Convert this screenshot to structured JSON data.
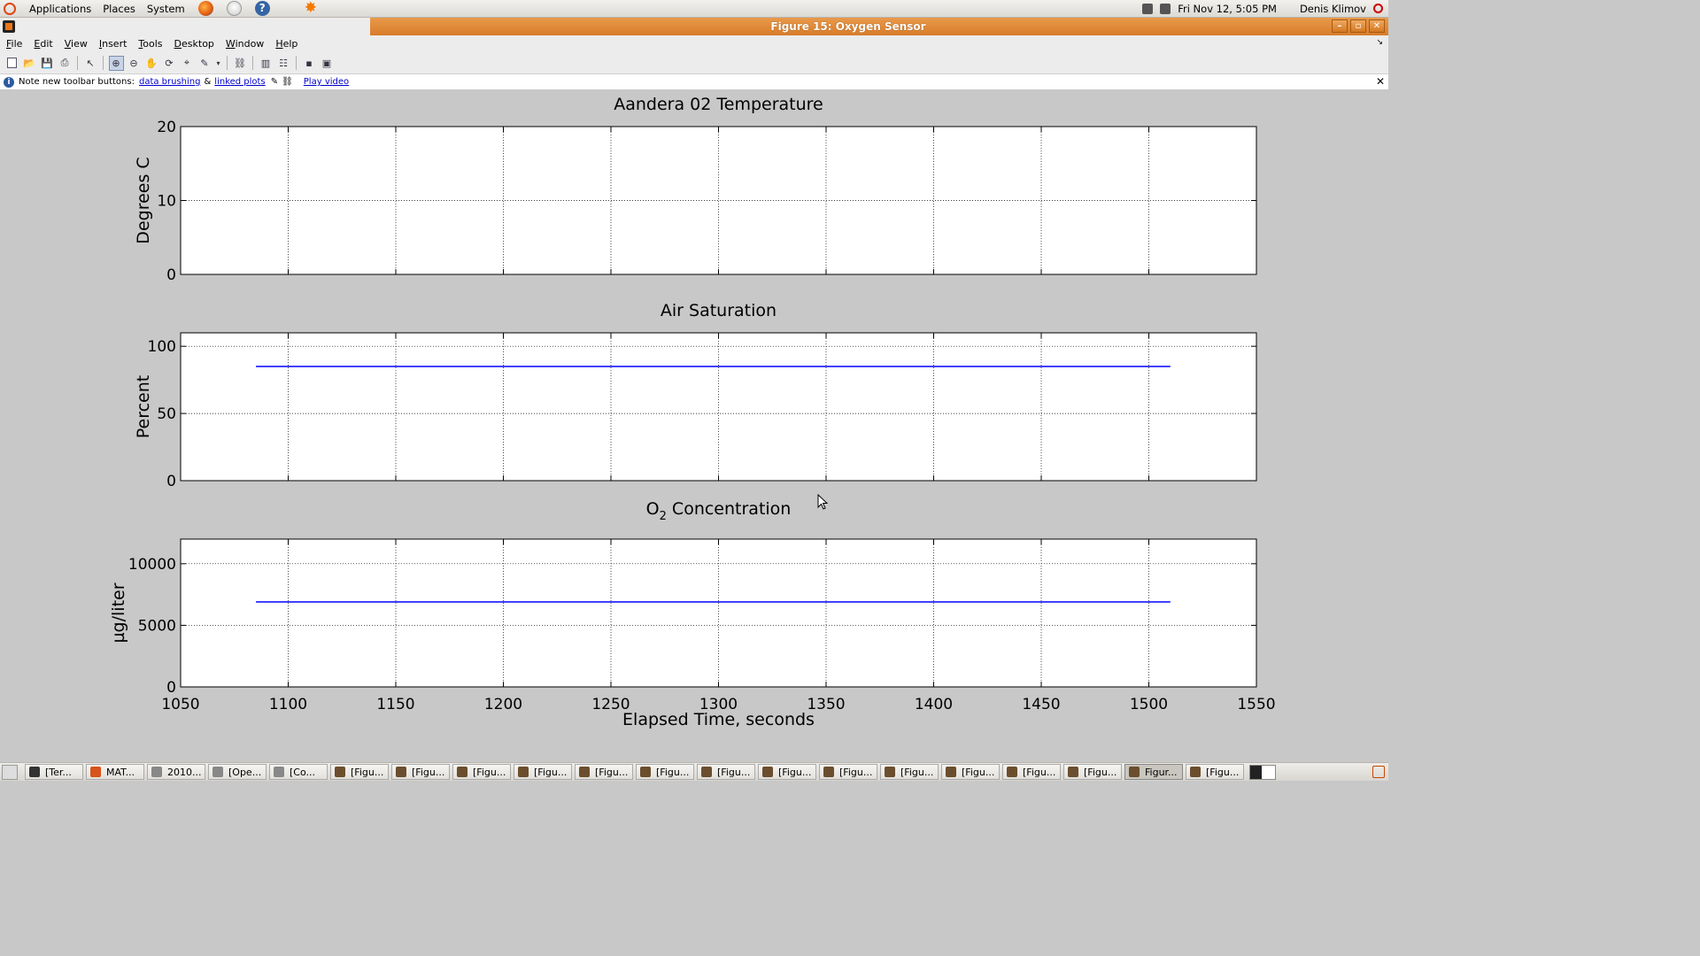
{
  "top_panel": {
    "menus": [
      "Applications",
      "Places",
      "System"
    ],
    "clock": "Fri Nov 12,  5:05 PM",
    "user": "Denis Klimov"
  },
  "window": {
    "title": "Figure 15: Oxygen Sensor"
  },
  "menubar": {
    "items": [
      "File",
      "Edit",
      "View",
      "Insert",
      "Tools",
      "Desktop",
      "Window",
      "Help"
    ]
  },
  "infobar": {
    "text": "Note new toolbar buttons:",
    "link1": "data brushing",
    "amp": "&",
    "link2": "linked plots",
    "link3": "Play video",
    "close": "✕"
  },
  "chart_data": [
    {
      "type": "line",
      "title": "Aandera 02 Temperature",
      "xlabel": "",
      "ylabel": "Degrees C",
      "xlim": [
        1050,
        1550
      ],
      "ylim": [
        0,
        20
      ],
      "xticks": [
        1100,
        1150,
        1200,
        1250,
        1300,
        1350,
        1400,
        1450,
        1500
      ],
      "yticks": [
        0,
        10,
        20
      ],
      "grid": true,
      "series": []
    },
    {
      "type": "line",
      "title": "Air Saturation",
      "xlabel": "",
      "ylabel": "Percent",
      "xlim": [
        1050,
        1550
      ],
      "ylim": [
        0,
        110
      ],
      "xticks": [
        1100,
        1150,
        1200,
        1250,
        1300,
        1350,
        1400,
        1450,
        1500
      ],
      "yticks": [
        0,
        50,
        100
      ],
      "grid": true,
      "series": [
        {
          "x": [
            1085,
            1200,
            1300,
            1400,
            1510
          ],
          "y": [
            85,
            85,
            85,
            85,
            85
          ],
          "color": "#0000ff"
        }
      ]
    },
    {
      "type": "line",
      "title": "O2 Concentration",
      "title_main": "O",
      "title_sub": "2",
      "title_rest": " Concentration",
      "xlabel": "Elapsed Time,  seconds",
      "ylabel": "µg/liter",
      "xlim": [
        1050,
        1550
      ],
      "ylim": [
        0,
        12000
      ],
      "xticks": [
        1050,
        1100,
        1150,
        1200,
        1250,
        1300,
        1350,
        1400,
        1450,
        1500,
        1550
      ],
      "yticks": [
        0,
        5000,
        10000
      ],
      "grid": true,
      "series": [
        {
          "x": [
            1085,
            1200,
            1300,
            1400,
            1510
          ],
          "y": [
            6900,
            6900,
            6900,
            6900,
            6900
          ],
          "color": "#0000ff"
        }
      ]
    }
  ],
  "taskbar": {
    "tasks": [
      {
        "label": "[Ter...",
        "icon": "term"
      },
      {
        "label": "MAT...",
        "icon": "mat"
      },
      {
        "label": "2010...",
        "icon": "doc"
      },
      {
        "label": "[Ope...",
        "icon": "doc"
      },
      {
        "label": "[Co...",
        "icon": "doc"
      },
      {
        "label": "[Figu...",
        "icon": "fig"
      },
      {
        "label": "[Figu...",
        "icon": "fig"
      },
      {
        "label": "[Figu...",
        "icon": "fig"
      },
      {
        "label": "[Figu...",
        "icon": "fig"
      },
      {
        "label": "[Figu...",
        "icon": "fig"
      },
      {
        "label": "[Figu...",
        "icon": "fig"
      },
      {
        "label": "[Figu...",
        "icon": "fig"
      },
      {
        "label": "[Figu...",
        "icon": "fig"
      },
      {
        "label": "[Figu...",
        "icon": "fig"
      },
      {
        "label": "[Figu...",
        "icon": "fig"
      },
      {
        "label": "[Figu...",
        "icon": "fig"
      },
      {
        "label": "[Figu...",
        "icon": "fig"
      },
      {
        "label": "[Figu...",
        "icon": "fig"
      },
      {
        "label": "Figur...",
        "icon": "fig",
        "active": true
      },
      {
        "label": "[Figu...",
        "icon": "fig"
      }
    ]
  }
}
